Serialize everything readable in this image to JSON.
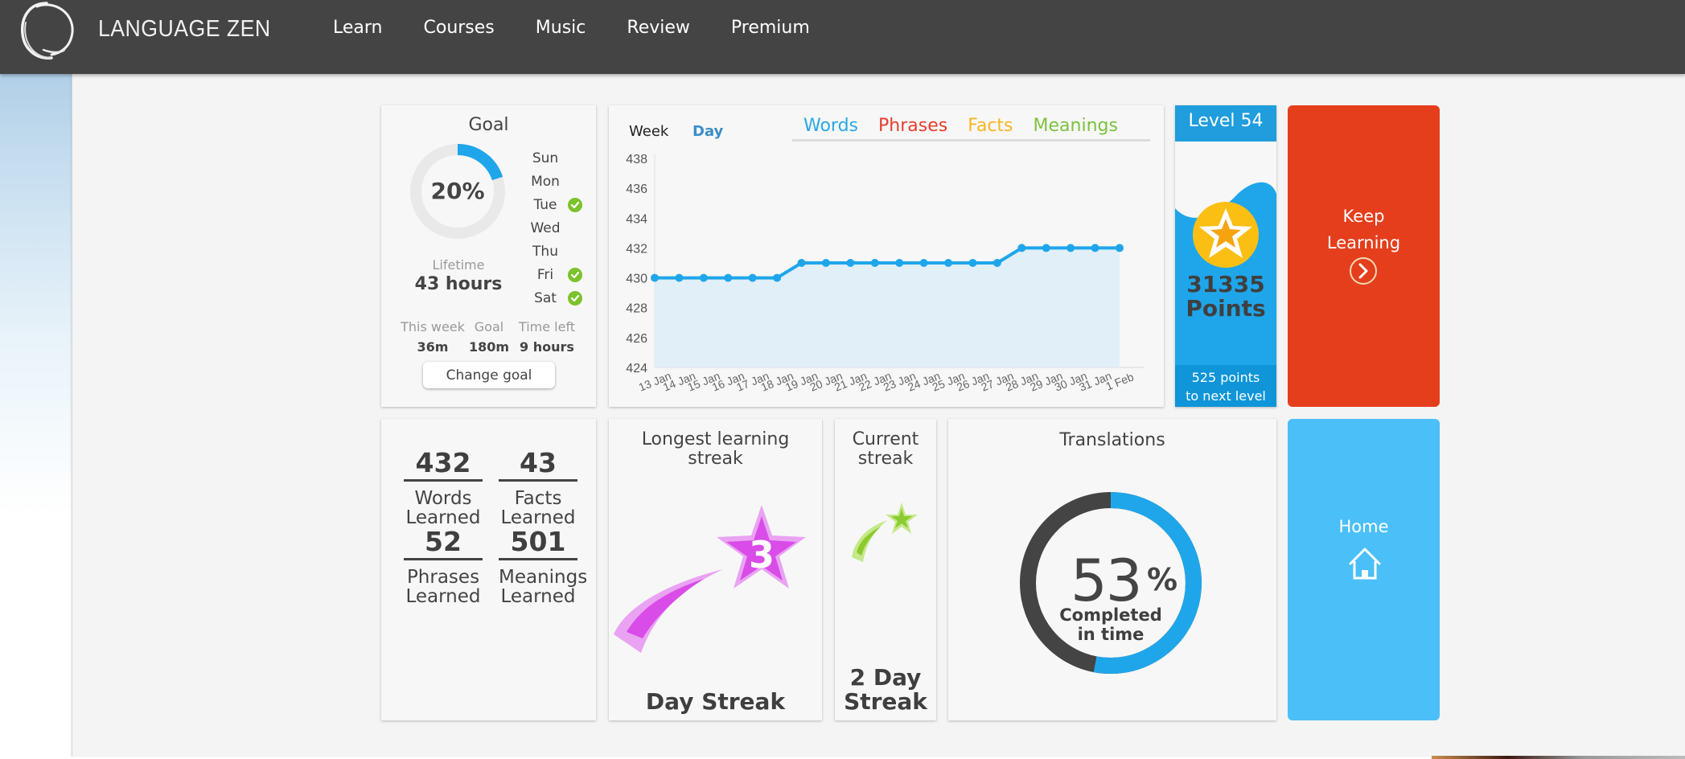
{
  "header": {
    "brand": "LANGUAGE ZEN",
    "nav": [
      "Learn",
      "Courses",
      "Music",
      "Review",
      "Premium"
    ]
  },
  "goal": {
    "title": "Goal",
    "percent_label": "20%",
    "percent_value": 20,
    "days": [
      {
        "name": "Sun",
        "done": false
      },
      {
        "name": "Mon",
        "done": false
      },
      {
        "name": "Tue",
        "done": true
      },
      {
        "name": "Wed",
        "done": false
      },
      {
        "name": "Thu",
        "done": false
      },
      {
        "name": "Fri",
        "done": true
      },
      {
        "name": "Sat",
        "done": true
      }
    ],
    "lifetime_label": "Lifetime",
    "lifetime_value": "43 hours",
    "stats": [
      {
        "label": "This week",
        "value": "36m"
      },
      {
        "label": "Goal",
        "value": "180m"
      },
      {
        "label": "Time left",
        "value": "9 hours"
      }
    ],
    "change_goal_label": "Change goal"
  },
  "chart_tabs": {
    "week": "Week",
    "day": "Day",
    "active": "Day"
  },
  "chart_legend": [
    {
      "label": "Words",
      "color": "#2aa8e6"
    },
    {
      "label": "Phrases",
      "color": "#e53e2d"
    },
    {
      "label": "Facts",
      "color": "#f9b521"
    },
    {
      "label": "Meanings",
      "color": "#7cc23f"
    }
  ],
  "chart_data": {
    "type": "area",
    "title": "",
    "xlabel": "",
    "ylabel": "",
    "x": [
      "13 Jan",
      "14 Jan",
      "15 Jan",
      "16 Jan",
      "17 Jan",
      "18 Jan",
      "19 Jan",
      "20 Jan",
      "21 Jan",
      "22 Jan",
      "23 Jan",
      "24 Jan",
      "25 Jan",
      "26 Jan",
      "27 Jan",
      "28 Jan",
      "29 Jan",
      "30 Jan",
      "31 Jan",
      "1 Feb"
    ],
    "series": [
      {
        "name": "Words",
        "color": "#1fa6ea",
        "values": [
          430,
          430,
          430,
          430,
          430,
          430,
          431,
          431,
          431,
          431,
          431,
          431,
          431,
          431,
          431,
          432,
          432,
          432,
          432,
          432
        ]
      }
    ],
    "ylim": [
      424,
      438
    ],
    "yticks": [
      424,
      426,
      428,
      430,
      432,
      434,
      436,
      438
    ],
    "grid": false,
    "legend": "top-right"
  },
  "level": {
    "title": "Level 54",
    "points": "31335",
    "points_label": "Points",
    "next_level": "525 points to next level",
    "next_line1": "525 points",
    "next_line2": "to next level"
  },
  "keep_learning": {
    "line1": "Keep",
    "line2": "Learning"
  },
  "home": {
    "label": "Home"
  },
  "counts": [
    {
      "value": "432",
      "line1": "Words",
      "line2": "Learned"
    },
    {
      "value": "43",
      "line1": "Facts",
      "line2": "Learned"
    },
    {
      "value": "52",
      "line1": "Phrases",
      "line2": "Learned"
    },
    {
      "value": "501",
      "line1": "Meanings",
      "line2": "Learned"
    }
  ],
  "longest_streak": {
    "title_line1": "Longest learning",
    "title_line2": "streak",
    "days": "3",
    "bottom": "Day Streak"
  },
  "current_streak": {
    "title_line1": "Current",
    "title_line2": "streak",
    "bottom_line1": "2 Day",
    "bottom_line2": "Streak"
  },
  "translations": {
    "title": "Translations",
    "percent_value": 53,
    "number": "53",
    "percent_sign": "%",
    "line1": "Completed",
    "line2": "in time"
  },
  "colors": {
    "nav_bg": "#444444",
    "accent_blue": "#1fa6ea",
    "keep_learning_red": "#e53e1c",
    "home_blue": "#4bbff7",
    "check_green": "#7cc22c",
    "streak_purple": "#d94ce8",
    "streak_green": "#9ccf3a",
    "star_gold": "#fbbf14"
  }
}
